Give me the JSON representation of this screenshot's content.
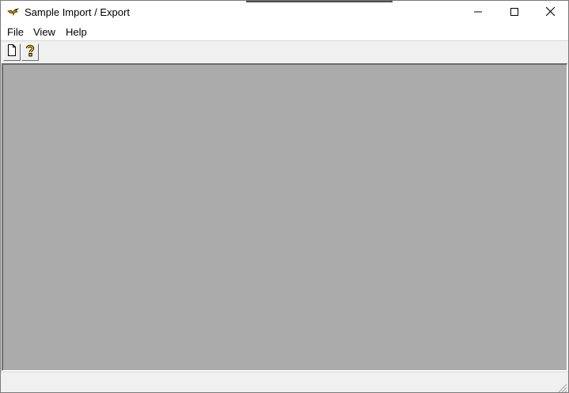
{
  "window": {
    "title": "Sample Import / Export",
    "app_icon": "app-bird-icon",
    "caption_buttons": [
      "minimize-icon",
      "maximize-icon",
      "close-icon"
    ]
  },
  "menubar": {
    "items": [
      {
        "label": "File"
      },
      {
        "label": "View"
      },
      {
        "label": "Help"
      }
    ]
  },
  "toolbar": {
    "buttons": [
      {
        "icon": "new-document-icon"
      },
      {
        "icon": "help-about-icon"
      }
    ]
  },
  "client_area": {
    "background_color": "#ababab"
  },
  "statusbar": {
    "text": ""
  }
}
